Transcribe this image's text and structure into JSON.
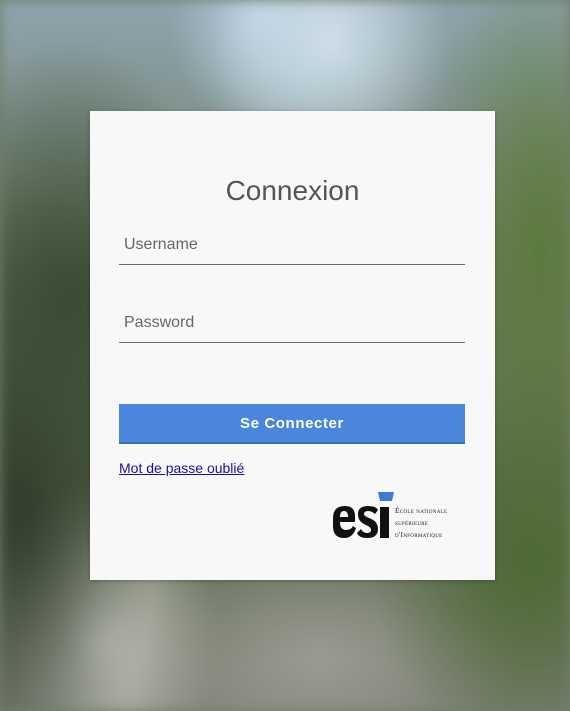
{
  "login": {
    "title": "Connexion",
    "username_placeholder": "Username",
    "password_placeholder": "Password",
    "submit_label": "Se Connecter",
    "forgot_label": "Mot de passe oublié"
  },
  "logo": {
    "mark": "esi",
    "line1": "École nationale",
    "line2": "supérieure",
    "line3": "d'Informatique",
    "mark_color": "#111111",
    "accent_color": "#3a7bd5"
  },
  "colors": {
    "button": "#4a86db",
    "card": "#f8f8f8",
    "link": "#1a0dab"
  }
}
